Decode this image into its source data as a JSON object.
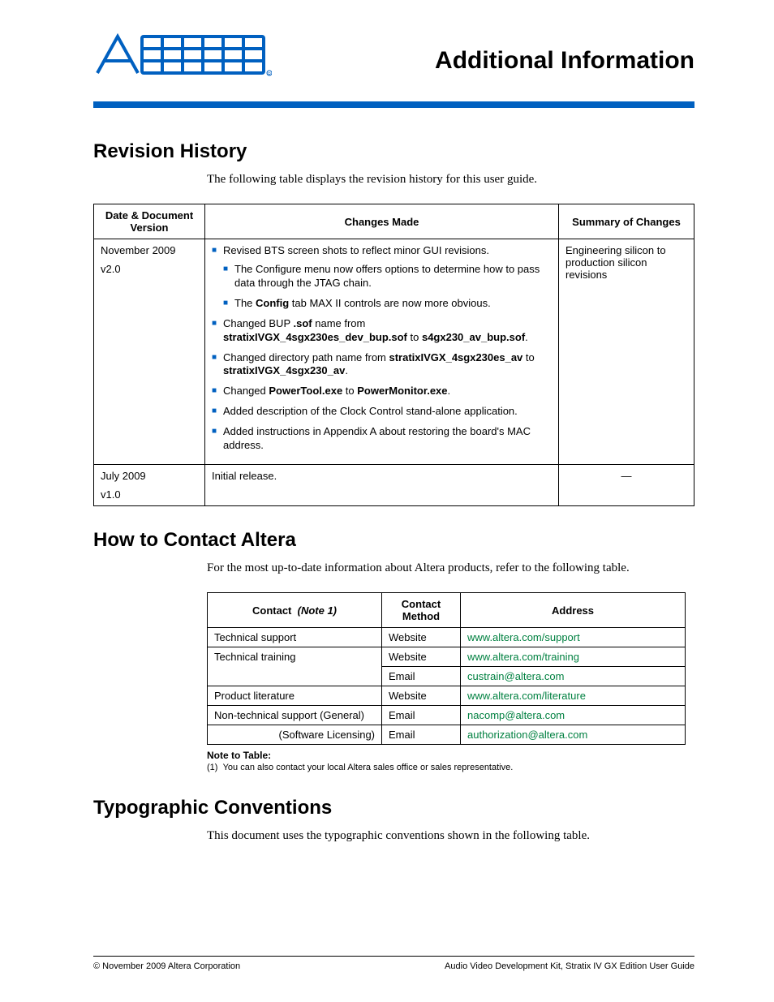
{
  "header": {
    "page_title": "Additional Information"
  },
  "sections": {
    "revision_history": {
      "heading": "Revision History",
      "intro": "The following table displays the revision history for this user guide."
    },
    "contact": {
      "heading": "How to Contact Altera",
      "intro": "For the most up-to-date information about Altera products, refer to the following table."
    },
    "typographic": {
      "heading": "Typographic Conventions",
      "intro": "This document uses the typographic conventions shown in the following table."
    }
  },
  "rev_table": {
    "headers": {
      "date": "Date & Document Version",
      "changes": "Changes Made",
      "summary": "Summary of Changes"
    },
    "rows": [
      {
        "date_line1": "November 2009",
        "date_line2": "v2.0",
        "summary": "Engineering silicon to production silicon revisions"
      },
      {
        "date_line1": "July 2009",
        "date_line2": "v1.0",
        "changes_text": "Initial release.",
        "summary": "—"
      }
    ],
    "row0_changes": {
      "b1": "Revised BTS screen shots to reflect minor GUI revisions.",
      "b1s1": "The Configure menu now offers options to determine how to pass data through the JTAG chain.",
      "b1s2_a": "The ",
      "b1s2_b": "Config",
      "b1s2_c": " tab MAX II controls are now more obvious.",
      "b2_a": "Changed BUP ",
      "b2_b": ".sof",
      "b2_c": " name from ",
      "b2_d": "stratixIVGX_4sgx230es_dev_bup.sof",
      "b2_e": " to ",
      "b2_f": "s4gx230_av_bup.sof",
      "b2_g": ".",
      "b3_a": "Changed directory path name from ",
      "b3_b": "stratixIVGX_4sgx230es_av",
      "b3_c": " to ",
      "b3_d": "stratixIVGX_4sgx230_av",
      "b3_e": ".",
      "b4_a": "Changed ",
      "b4_b": "PowerTool.exe",
      "b4_c": " to ",
      "b4_d": "PowerMonitor.exe",
      "b4_e": ".",
      "b5": "Added description of the Clock Control stand-alone application.",
      "b6": "Added instructions in Appendix A about restoring the board's MAC address."
    }
  },
  "contact_table": {
    "headers": {
      "contact": "Contact",
      "note_ref": "(Note 1)",
      "method": "Contact Method",
      "address": "Address"
    },
    "rows": [
      {
        "contact": "Technical support",
        "method": "Website",
        "address": "www.altera.com/support"
      },
      {
        "contact": "Technical training",
        "method": "Website",
        "address": "www.altera.com/training"
      },
      {
        "contact": "",
        "method": "Email",
        "address": "custrain@altera.com"
      },
      {
        "contact": "Product literature",
        "method": "Website",
        "address": "www.altera.com/literature"
      },
      {
        "contact": "Non-technical support (General)",
        "method": "Email",
        "address": "nacomp@altera.com"
      },
      {
        "contact": "(Software Licensing)",
        "method": "Email",
        "address": "authorization@altera.com"
      }
    ],
    "note_label": "Note to Table:",
    "note_num": "(1)",
    "note_text": "You can also contact your local Altera sales office or sales representative."
  },
  "footer": {
    "left": "© November 2009   Altera Corporation",
    "right": "Audio Video Development Kit, Stratix IV GX Edition User Guide"
  }
}
